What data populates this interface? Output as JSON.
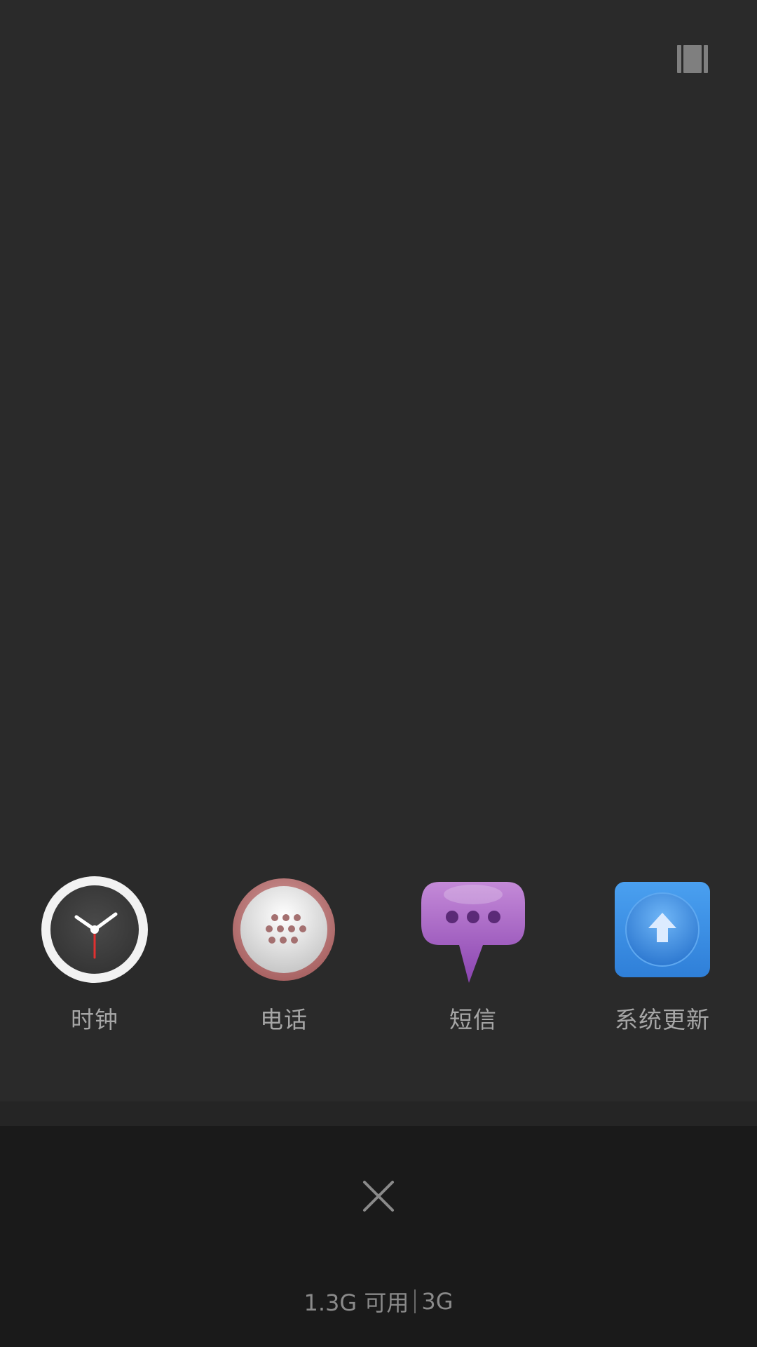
{
  "apps": [
    {
      "label": "时钟",
      "icon": "clock-icon"
    },
    {
      "label": "电话",
      "icon": "phone-dialpad-icon"
    },
    {
      "label": "短信",
      "icon": "message-bubble-icon"
    },
    {
      "label": "系统更新",
      "icon": "system-update-icon"
    }
  ],
  "memory": {
    "available": "1.3G 可用",
    "total": "3G"
  },
  "icons": {
    "layout_toggle": "grid-view-icon",
    "close": "close-icon"
  },
  "colors": {
    "background": "#2a2a2a",
    "bottom_bar": "#1a1a1a",
    "label": "#a6a6a6"
  }
}
